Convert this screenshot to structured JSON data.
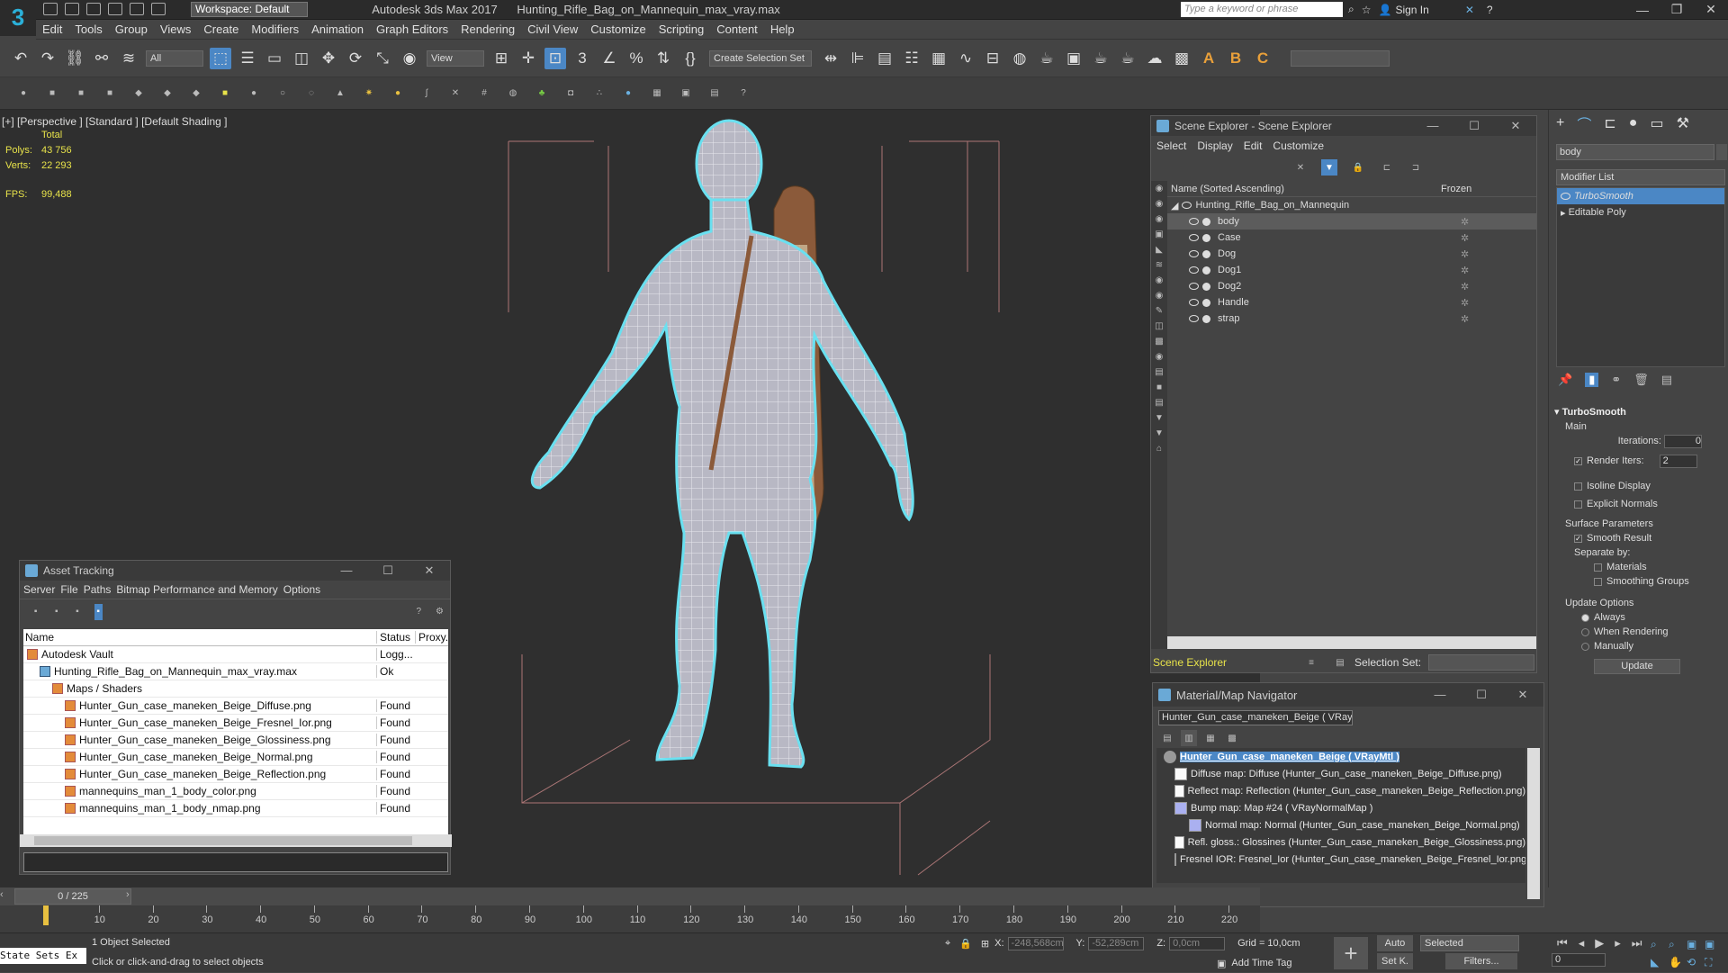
{
  "window": {
    "app_title": "Autodesk 3ds Max 2017",
    "file_title": "Hunting_Rifle_Bag_on_Mannequin_max_vray.max",
    "workspace": "Workspace: Default",
    "search_placeholder": "Type a keyword or phrase",
    "sign_in": "Sign In",
    "logo": "3"
  },
  "menu": [
    "Edit",
    "Tools",
    "Group",
    "Views",
    "Create",
    "Modifiers",
    "Animation",
    "Graph Editors",
    "Rendering",
    "Civil View",
    "Customize",
    "Scripting",
    "Content",
    "Help"
  ],
  "toolbar": {
    "filter": "All",
    "view": "View",
    "selection_set": "Create Selection Set"
  },
  "viewport": {
    "label": "[+] [Perspective ] [Standard ] [Default Shading ]",
    "total": "Total",
    "polys_label": "Polys:",
    "polys": "43 756",
    "verts_label": "Verts:",
    "verts": "22 293",
    "fps_label": "FPS:",
    "fps": "99,488"
  },
  "asset_tracking": {
    "title": "Asset Tracking",
    "menu": [
      "Server",
      "File",
      "Paths",
      "Bitmap Performance and Memory",
      "Options"
    ],
    "columns": [
      "Name",
      "Status",
      "Proxy..."
    ],
    "rows": [
      {
        "name": "Autodesk Vault",
        "status": "Logg...",
        "indent": 0
      },
      {
        "name": "Hunting_Rifle_Bag_on_Mannequin_max_vray.max",
        "status": "Ok",
        "indent": 1
      },
      {
        "name": "Maps / Shaders",
        "status": "",
        "indent": 2
      },
      {
        "name": "Hunter_Gun_case_maneken_Beige_Diffuse.png",
        "status": "Found",
        "indent": 3
      },
      {
        "name": "Hunter_Gun_case_maneken_Beige_Fresnel_Ior.png",
        "status": "Found",
        "indent": 3
      },
      {
        "name": "Hunter_Gun_case_maneken_Beige_Glossiness.png",
        "status": "Found",
        "indent": 3
      },
      {
        "name": "Hunter_Gun_case_maneken_Beige_Normal.png",
        "status": "Found",
        "indent": 3
      },
      {
        "name": "Hunter_Gun_case_maneken_Beige_Reflection.png",
        "status": "Found",
        "indent": 3
      },
      {
        "name": "mannequins_man_1_body_color.png",
        "status": "Found",
        "indent": 3
      },
      {
        "name": "mannequins_man_1_body_nmap.png",
        "status": "Found",
        "indent": 3
      }
    ]
  },
  "scene_explorer": {
    "title": "Scene Explorer - Scene Explorer",
    "menu": [
      "Select",
      "Display",
      "Edit",
      "Customize"
    ],
    "col_name": "Name (Sorted Ascending)",
    "col_frozen": "Frozen",
    "root": "Hunting_Rifle_Bag_on_Mannequin",
    "items": [
      "body",
      "Case",
      "Dog",
      "Dog1",
      "Dog2",
      "Handle",
      "strap"
    ],
    "footer_label": "Scene Explorer",
    "selection_set_label": "Selection Set:"
  },
  "command_panel": {
    "object_name": "body",
    "modifier_list": "Modifier List",
    "stack": [
      "TurboSmooth",
      "Editable Poly"
    ],
    "rollout": "TurboSmooth",
    "main": "Main",
    "iterations_label": "Iterations:",
    "iterations": "0",
    "render_iters_label": "Render Iters:",
    "render_iters": "2",
    "isoline": "Isoline Display",
    "explicit_normals": "Explicit Normals",
    "surface_params": "Surface Parameters",
    "smooth_result": "Smooth Result",
    "separate_by": "Separate by:",
    "materials": "Materials",
    "smoothing_groups": "Smoothing Groups",
    "update_options": "Update Options",
    "always": "Always",
    "when_rendering": "When Rendering",
    "manually": "Manually",
    "update_button": "Update"
  },
  "material_navigator": {
    "title": "Material/Map Navigator",
    "current": "Hunter_Gun_case_maneken_Beige  ( VRayMtl",
    "root": "Hunter_Gun_case_maneken_Beige  ( VRayMtl )",
    "maps": [
      "Diffuse map: Diffuse (Hunter_Gun_case_maneken_Beige_Diffuse.png)",
      "Reflect map: Reflection (Hunter_Gun_case_maneken_Beige_Reflection.png)",
      "Bump map: Map #24  ( VRayNormalMap )",
      "Normal map: Normal (Hunter_Gun_case_maneken_Beige_Normal.png)",
      "Refl. gloss.: Glossines (Hunter_Gun_case_maneken_Beige_Glossiness.png)",
      "Fresnel IOR: Fresnel_Ior (Hunter_Gun_case_maneken_Beige_Fresnel_Ior.png)"
    ]
  },
  "timeline": {
    "frame": "0 / 225",
    "ticks": [
      "10",
      "20",
      "30",
      "40",
      "50",
      "60",
      "70",
      "80",
      "90",
      "100",
      "110",
      "120",
      "130",
      "140",
      "150",
      "160",
      "170",
      "180",
      "190",
      "200",
      "210",
      "220"
    ]
  },
  "status": {
    "state_sets": "State Sets Ex",
    "selected": "1 Object Selected",
    "hint": "Click or click-and-drag to select objects",
    "x_label": "X:",
    "x": "-248,568cm",
    "y_label": "Y:",
    "y": "-52,289cm",
    "z_label": "Z:",
    "z": "0,0cm",
    "grid": "Grid = 10,0cm",
    "add_time_tag": "Add Time Tag",
    "auto": "Auto",
    "set_key": "Set K.",
    "selected_dd": "Selected",
    "filters": "Filters...",
    "frame_field": "0"
  },
  "colors": {
    "accent": "#4b87c5",
    "wire": "#6ae0f0",
    "stats": "#e8e34a"
  }
}
